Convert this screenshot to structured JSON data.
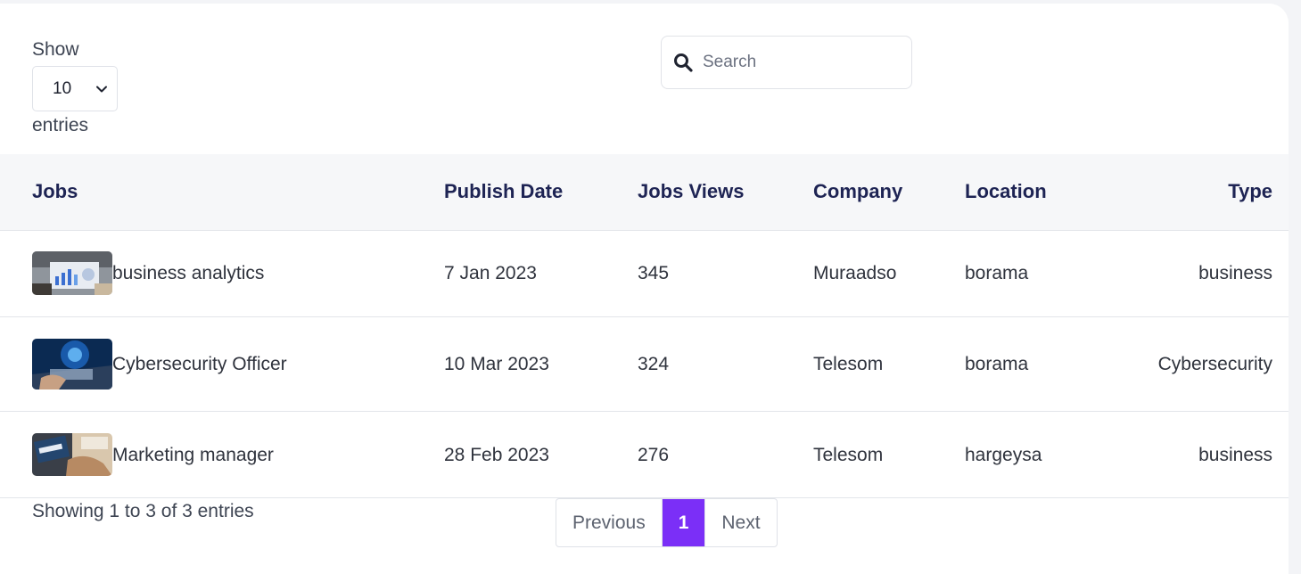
{
  "length_control": {
    "show_label": "Show",
    "selected": "10",
    "entries_label": "entries"
  },
  "search": {
    "placeholder": "Search"
  },
  "table": {
    "headers": [
      "Jobs",
      "Publish Date",
      "Jobs Views",
      "Company",
      "Location",
      "Type"
    ],
    "rows": [
      {
        "job": "business analytics",
        "date": "7 Jan 2023",
        "views": "345",
        "company": "Muraadso",
        "location": "borama",
        "type": "business",
        "thumb_icon": "business-analytics-thumbnail"
      },
      {
        "job": "Cybersecurity Officer",
        "date": "10 Mar 2023",
        "views": "324",
        "company": "Telesom",
        "location": "borama",
        "type": "Cybersecurity",
        "thumb_icon": "cybersecurity-thumbnail"
      },
      {
        "job": "Marketing manager",
        "date": "28 Feb 2023",
        "views": "276",
        "company": "Telesom",
        "location": "hargeysa",
        "type": "business",
        "thumb_icon": "marketing-thumbnail"
      }
    ]
  },
  "footer": {
    "info": "Showing 1 to 3 of 3 entries",
    "prev": "Previous",
    "current_page": "1",
    "next": "Next"
  },
  "colors": {
    "accent": "#7b2ff7",
    "header_text": "#1e2454",
    "header_bg": "#f6f7f9"
  }
}
